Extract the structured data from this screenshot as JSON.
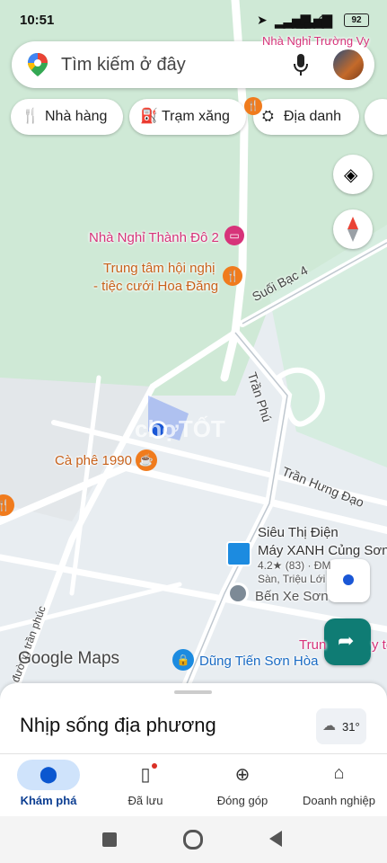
{
  "status_bar": {
    "time": "10:51",
    "battery": "92"
  },
  "search": {
    "placeholder": "Tìm kiếm ở đây"
  },
  "chips": [
    {
      "label": "Nhà hàng",
      "icon": "fork-knife-icon"
    },
    {
      "label": "Trạm xăng",
      "icon": "gas-station-icon"
    },
    {
      "label": "Địa danh",
      "icon": "landmark-icon"
    }
  ],
  "map": {
    "places": {
      "nha_nghi_thanh_do": "Nhà Nghỉ Thành Đô 2",
      "nha_nghi_truong_vy": "Nhà Nghỉ Trường Vy",
      "trung_tam_line1": "Trung tâm hội nghị",
      "trung_tam_line2": "- tiệc cưới Hoa Đăng",
      "ca_phe": "Cà phê 1990",
      "sieu_thi_line1": "Siêu Thị Điện",
      "sieu_thi_line2": "Máy XANH Củng Sơn",
      "sieu_thi_rating": "4.2★ (83) · ĐM",
      "sieu_thi_addr": "Sàn, Triệu Lới",
      "ben_xe": "Bến Xe Sơn",
      "dung_tien": "Dũng Tiến Sơn Hòa",
      "trung_partial": "Trun",
      "te_partial": "y tế"
    },
    "streets": {
      "suoi_bac": "Suối Bạc 4",
      "tran_phu": "Trần Phú",
      "tran_hung_dao": "Trần Hưng Đạo",
      "tran_phuc": "đường trần phúc"
    },
    "watermark": "chợTỐT",
    "logo": "Google Maps"
  },
  "sheet": {
    "title": "Nhịp sống địa phương",
    "weather": "31°"
  },
  "nav": [
    {
      "label": "Khám phá",
      "icon": "explore-pin-icon",
      "active": true
    },
    {
      "label": "Đã lưu",
      "icon": "bookmark-icon",
      "active": false
    },
    {
      "label": "Đóng góp",
      "icon": "add-circle-icon",
      "active": false
    },
    {
      "label": "Doanh nghiệp",
      "icon": "storefront-icon",
      "active": false
    }
  ],
  "colors": {
    "accent": "#0b57d0",
    "park": "#cfe9d6",
    "road": "#ffffff",
    "directions": "#0f7c74"
  }
}
